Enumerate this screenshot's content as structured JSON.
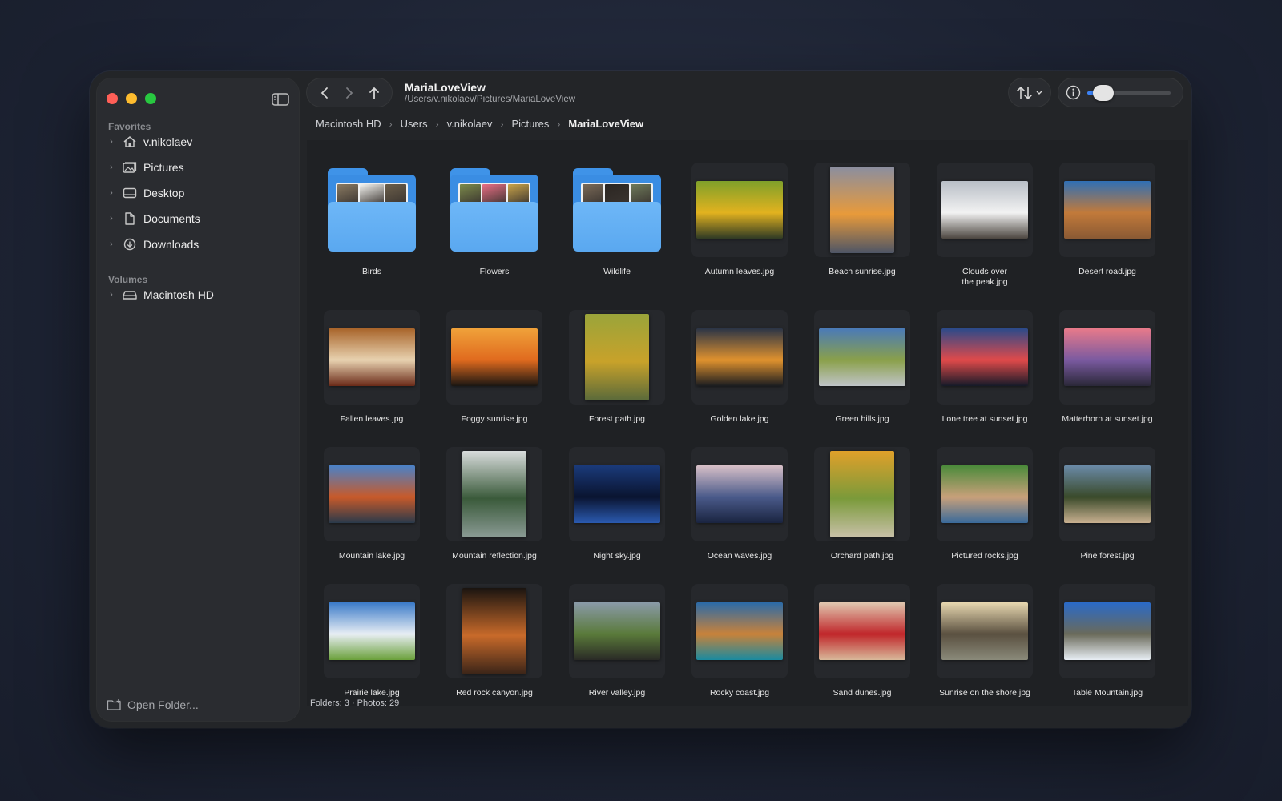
{
  "window": {
    "title": "MariaLoveView",
    "path": "/Users/v.nikolaev/Pictures/MariaLoveView"
  },
  "sidebar": {
    "favorites_label": "Favorites",
    "favorites": [
      {
        "label": "v.nikolaev",
        "icon": "home-icon"
      },
      {
        "label": "Pictures",
        "icon": "pictures-icon"
      },
      {
        "label": "Desktop",
        "icon": "desktop-icon"
      },
      {
        "label": "Documents",
        "icon": "document-icon"
      },
      {
        "label": "Downloads",
        "icon": "download-icon"
      }
    ],
    "volumes_label": "Volumes",
    "volumes": [
      {
        "label": "Macintosh HD",
        "icon": "drive-icon"
      }
    ],
    "open_folder_label": "Open Folder..."
  },
  "toolbar": {
    "size_slider_value": 0.12
  },
  "breadcrumb": [
    "Macintosh HD",
    "Users",
    "v.nikolaev",
    "Pictures",
    "MariaLoveView"
  ],
  "items": [
    {
      "name": "Birds",
      "kind": "folder",
      "colors": [
        "#8a7a62",
        "#f4f4f0",
        "#6b5e4a"
      ]
    },
    {
      "name": "Flowers",
      "kind": "folder",
      "colors": [
        "#7b8a4a",
        "#e86e84",
        "#c9a449"
      ]
    },
    {
      "name": "Wildlife",
      "kind": "folder",
      "colors": [
        "#7a6a58",
        "#2b2622",
        "#6e7a5a"
      ]
    },
    {
      "name": "Autumn leaves.jpg",
      "kind": "photo",
      "orient": "land",
      "colors": [
        "#7fa02a",
        "#e2b21f",
        "#2f3a24"
      ]
    },
    {
      "name": "Beach sunrise.jpg",
      "kind": "photo",
      "orient": "port",
      "colors": [
        "#8a8ea0",
        "#e89a3a",
        "#4d5566"
      ]
    },
    {
      "name": "Clouds over\nthe peak.jpg",
      "kind": "photo",
      "orient": "land",
      "colors": [
        "#b8bec6",
        "#f2f2f2",
        "#4c4640"
      ]
    },
    {
      "name": "Desert road.jpg",
      "kind": "photo",
      "orient": "land",
      "colors": [
        "#2f6fb5",
        "#c27a3a",
        "#8a5a34"
      ]
    },
    {
      "name": "Fallen leaves.jpg",
      "kind": "photo",
      "orient": "land",
      "colors": [
        "#a8642a",
        "#e8d2b0",
        "#6a2a18"
      ]
    },
    {
      "name": "Foggy sunrise.jpg",
      "kind": "photo",
      "orient": "land",
      "colors": [
        "#f0a23a",
        "#e06a1e",
        "#1a1612"
      ]
    },
    {
      "name": "Forest path.jpg",
      "kind": "photo",
      "orient": "port",
      "colors": [
        "#9aa43a",
        "#c8a22a",
        "#5a6a3a"
      ]
    },
    {
      "name": "Golden lake.jpg",
      "kind": "photo",
      "orient": "land",
      "colors": [
        "#2a3446",
        "#e0922e",
        "#1a1c20"
      ]
    },
    {
      "name": "Green hills.jpg",
      "kind": "photo",
      "orient": "land",
      "colors": [
        "#4a7ab8",
        "#8aa04a",
        "#c0c4c8"
      ]
    },
    {
      "name": "Lone tree at sunset.jpg",
      "kind": "photo",
      "orient": "land",
      "colors": [
        "#2a4a8a",
        "#e04a4a",
        "#151a28"
      ]
    },
    {
      "name": "Matterhorn at sunset.jpg",
      "kind": "photo",
      "orient": "land",
      "colors": [
        "#e87a8a",
        "#7a5aa0",
        "#2a2838"
      ]
    },
    {
      "name": "Mountain lake.jpg",
      "kind": "photo",
      "orient": "land",
      "colors": [
        "#4a82c8",
        "#c85a2a",
        "#2a3a4a"
      ]
    },
    {
      "name": "Mountain reflection.jpg",
      "kind": "photo",
      "orient": "port",
      "colors": [
        "#d8dcdc",
        "#3a5a3a",
        "#8a9a94"
      ]
    },
    {
      "name": "Night sky.jpg",
      "kind": "photo",
      "orient": "land",
      "colors": [
        "#1a3a7a",
        "#0a1430",
        "#2a5ab0"
      ]
    },
    {
      "name": "Ocean waves.jpg",
      "kind": "photo",
      "orient": "land",
      "colors": [
        "#d8c0c8",
        "#4a5a8a",
        "#1a2440"
      ]
    },
    {
      "name": "Orchard path.jpg",
      "kind": "photo",
      "orient": "port",
      "colors": [
        "#e0a02a",
        "#7a9a3a",
        "#c8c0a8"
      ]
    },
    {
      "name": "Pictured rocks.jpg",
      "kind": "photo",
      "orient": "land",
      "colors": [
        "#4a8a3a",
        "#c8a07a",
        "#3a6a9a"
      ]
    },
    {
      "name": "Pine forest.jpg",
      "kind": "photo",
      "orient": "land",
      "colors": [
        "#6a8aa8",
        "#3a4a2a",
        "#c8b090"
      ]
    },
    {
      "name": "Prairie lake.jpg",
      "kind": "photo",
      "orient": "land",
      "colors": [
        "#3a7ac8",
        "#e8eef4",
        "#6aa03a"
      ]
    },
    {
      "name": "Red rock canyon.jpg",
      "kind": "photo",
      "orient": "port",
      "colors": [
        "#1a1410",
        "#c86a2a",
        "#3a2418"
      ]
    },
    {
      "name": "River valley.jpg",
      "kind": "photo",
      "orient": "land",
      "colors": [
        "#8a9aa8",
        "#5a7a3a",
        "#2a2a26"
      ]
    },
    {
      "name": "Rocky coast.jpg",
      "kind": "photo",
      "orient": "land",
      "colors": [
        "#2a6aa8",
        "#c8823a",
        "#1a8aa0"
      ]
    },
    {
      "name": "Sand dunes.jpg",
      "kind": "photo",
      "orient": "land",
      "colors": [
        "#e0c8b0",
        "#c0262a",
        "#d8b89a"
      ]
    },
    {
      "name": "Sunrise on the shore.jpg",
      "kind": "photo",
      "orient": "land",
      "colors": [
        "#e8d8b0",
        "#5a5040",
        "#8a8a7a"
      ]
    },
    {
      "name": "Table Mountain.jpg",
      "kind": "photo",
      "orient": "land",
      "colors": [
        "#2a6ac8",
        "#6a6a5a",
        "#e8eef4"
      ]
    }
  ],
  "status": "Folders: 3 · Photos: 29"
}
